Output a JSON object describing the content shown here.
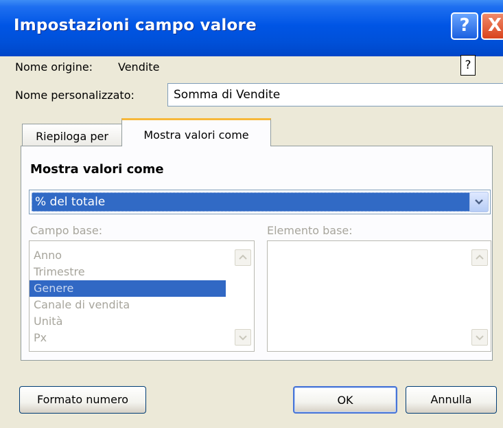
{
  "window": {
    "title": "Impostazioni campo valore",
    "help_button": "?",
    "close_button": "X"
  },
  "source": {
    "label": "Nome origine:",
    "value": "Vendite",
    "help_box": "?"
  },
  "custom_name": {
    "label": "Nome personalizzato:",
    "value": "Somma di Vendite"
  },
  "tabs": [
    {
      "label": "Riepiloga per",
      "active": false
    },
    {
      "label": "Mostra valori come",
      "active": true
    }
  ],
  "section": {
    "title": "Mostra valori come"
  },
  "dropdown": {
    "selected": "% del totale"
  },
  "base_field": {
    "label": "Campo base:",
    "items": [
      "Anno",
      "Trimestre",
      "Genere",
      "Canale di vendita",
      "Unità",
      "Px"
    ],
    "selected_index": 2
  },
  "base_item": {
    "label": "Elemento base:",
    "items": []
  },
  "buttons": {
    "format_number": "Formato numero",
    "ok": "OK",
    "cancel": "Annulla"
  },
  "colors": {
    "title_bar": "#0055e5",
    "selection": "#316ac5",
    "dialog_bg": "#ece9d8",
    "tab_highlight": "#f7b83a"
  }
}
